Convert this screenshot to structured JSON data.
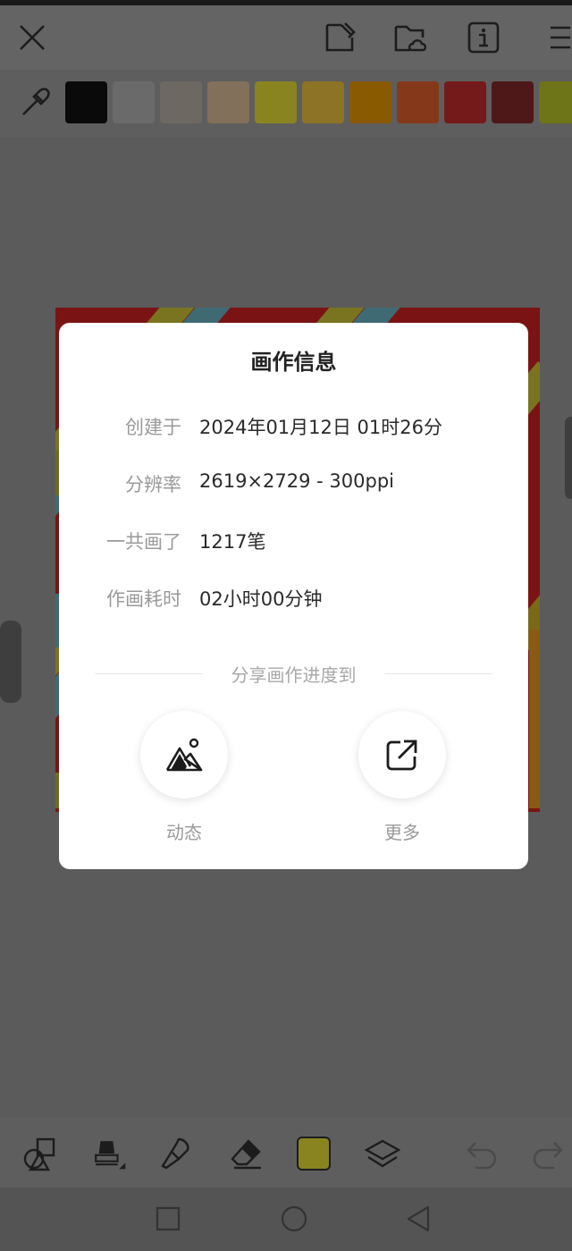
{
  "top_bar": {
    "icons": [
      "close-icon",
      "sticker-icon",
      "cloud-folder-icon",
      "info-icon",
      "menu-icon"
    ]
  },
  "palette": {
    "eyedropper_icon": "eyedropper-icon",
    "swatches": [
      "#0a0a0a",
      "#6a6a6a",
      "#6e6862",
      "#82705a",
      "#8a8420",
      "#8c7326",
      "#8a5a00",
      "#86381a",
      "#741a1a",
      "#4e1818",
      "#6e7418"
    ]
  },
  "dialog": {
    "title": "画作信息",
    "rows": [
      {
        "label": "创建于",
        "value": "2024年01月12日 01时26分"
      },
      {
        "label": "分辨率",
        "value": "2619×2729 - 300ppi"
      },
      {
        "label": "一共画了",
        "value": "1217笔"
      },
      {
        "label": "作画耗时",
        "value": "02小时00分钟"
      }
    ],
    "share_heading": "分享画作进度到",
    "share_options": [
      {
        "label": "动态",
        "icon": "image-mountain-icon"
      },
      {
        "label": "更多",
        "icon": "share-external-icon"
      }
    ]
  },
  "toolbar": {
    "tools": [
      "shapes-icon",
      "brush-icon",
      "smudge-icon",
      "eraser-icon",
      "color-swatch",
      "layers-icon",
      "undo-icon",
      "redo-icon"
    ],
    "current_color": "#8a8420"
  },
  "nav": {
    "buttons": [
      "recent-apps-icon",
      "home-icon",
      "back-icon"
    ]
  }
}
